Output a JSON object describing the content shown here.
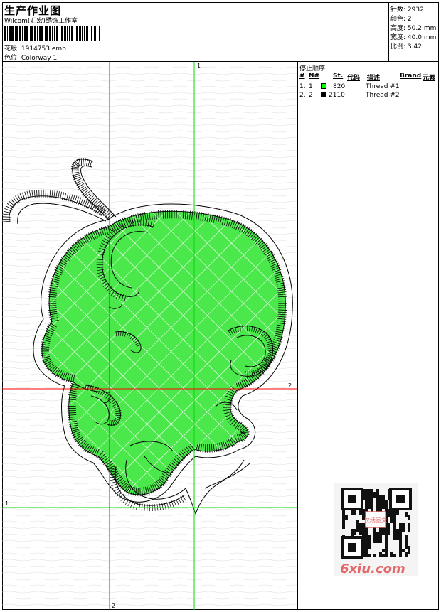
{
  "header": {
    "title": "生产作业图",
    "company": "Wilcom(汇宏)绣饰工作室",
    "file_label": "花版:",
    "file_value": "1914753.emb",
    "colorway_label": "色位:",
    "colorway_value": "Colorway 1"
  },
  "stats": [
    {
      "label": "针数:",
      "value": "2932"
    },
    {
      "label": "颜色:",
      "value": "2"
    },
    {
      "label": "高度:",
      "value": "50.2 mm"
    },
    {
      "label": "宽度:",
      "value": "40.0 mm"
    },
    {
      "label": "比例:",
      "value": "3.42"
    }
  ],
  "stop_sequence": {
    "title": "停止顺序:",
    "columns": [
      "#",
      "N#",
      "St.",
      "代码",
      "描述",
      "Brand",
      "元素"
    ],
    "rows": [
      {
        "index": "1.",
        "needle": "1",
        "code": "820",
        "description": "Thread #1",
        "color": "#00ff00"
      },
      {
        "index": "2.",
        "needle": "2",
        "code": "2110",
        "description": "Thread #2",
        "color": "#000000"
      }
    ]
  },
  "guides": {
    "green_top_label": "1",
    "green_left_label": "1",
    "red_right_label": "2",
    "red_bottom_label": "2"
  },
  "watermark": {
    "text": "6xiu.com",
    "seal": "汉绣图文"
  },
  "colors": {
    "fill_green": "#4be84b",
    "guide_green": "#00dd00",
    "guide_red": "#ff0000",
    "stitch": "#000000"
  }
}
